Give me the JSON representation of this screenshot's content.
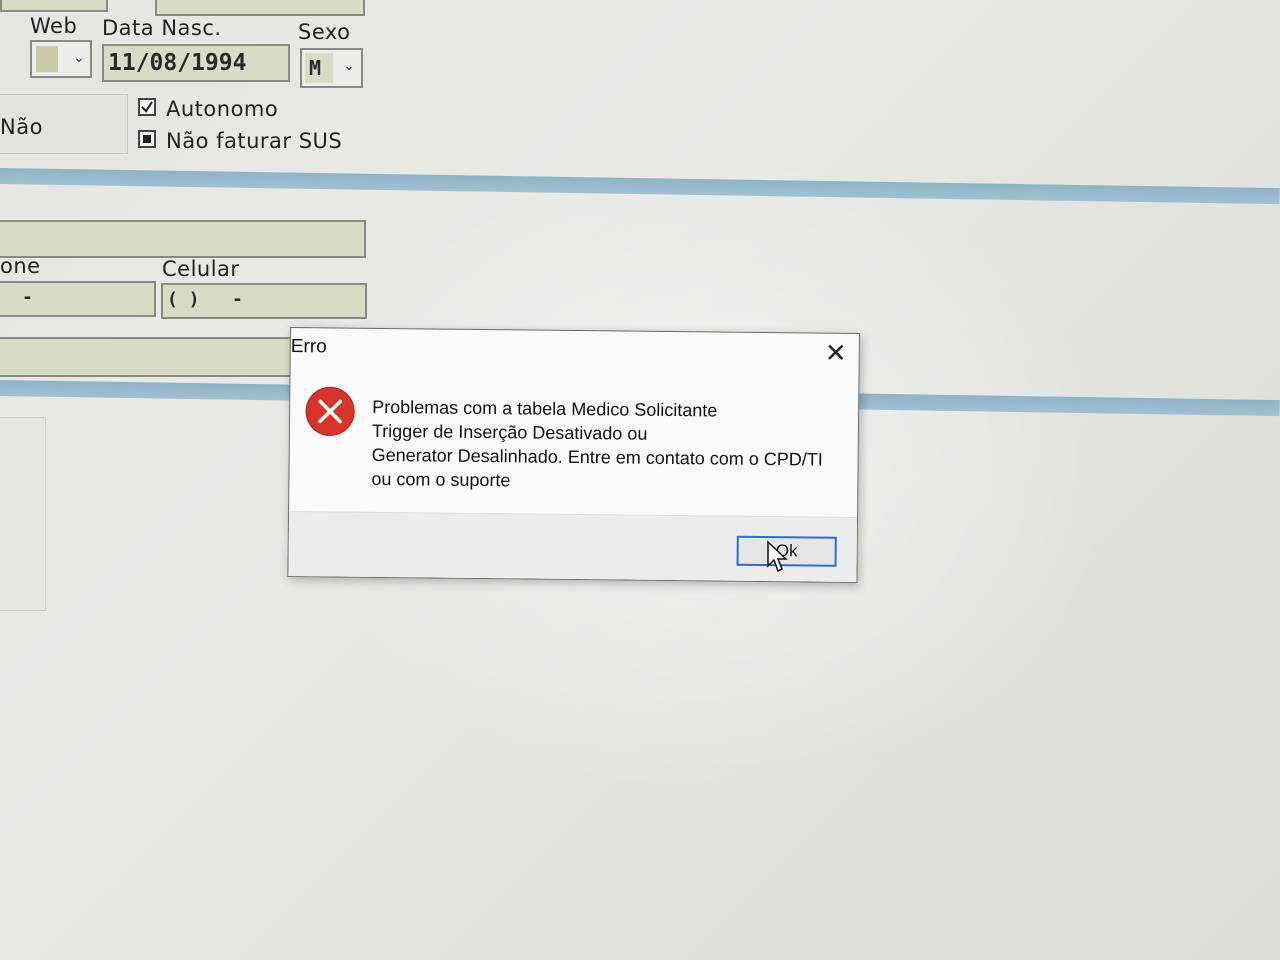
{
  "form": {
    "web_label": "Web",
    "data_nasc_label": "Data Nasc.",
    "data_nasc_value": "11/08/1994",
    "sexo_label": "Sexo",
    "sexo_value": "M",
    "nao_label": "Não",
    "autonomo_label": "Autonomo",
    "nao_faturar_sus_label": "Não faturar SUS",
    "fone_label": "one",
    "fone_value": "-",
    "celular_label": "Celular",
    "celular_value": "( )   -"
  },
  "dialog": {
    "title": "Erro",
    "close_glyph": "✕",
    "message_lines": [
      "Problemas com a tabela Medico Solicitante",
      "Trigger de Inserção Desativado ou",
      "Generator Desalinhado. Entre em contato com o CPD/TI",
      "ou com o suporte"
    ],
    "ok_label": "Ok",
    "icon": "error-icon"
  },
  "colors": {
    "field_bg": "#d9dcc4",
    "band": "#9fc0d2",
    "error_red": "#d9342b",
    "focus_border": "#2a6fd0"
  }
}
